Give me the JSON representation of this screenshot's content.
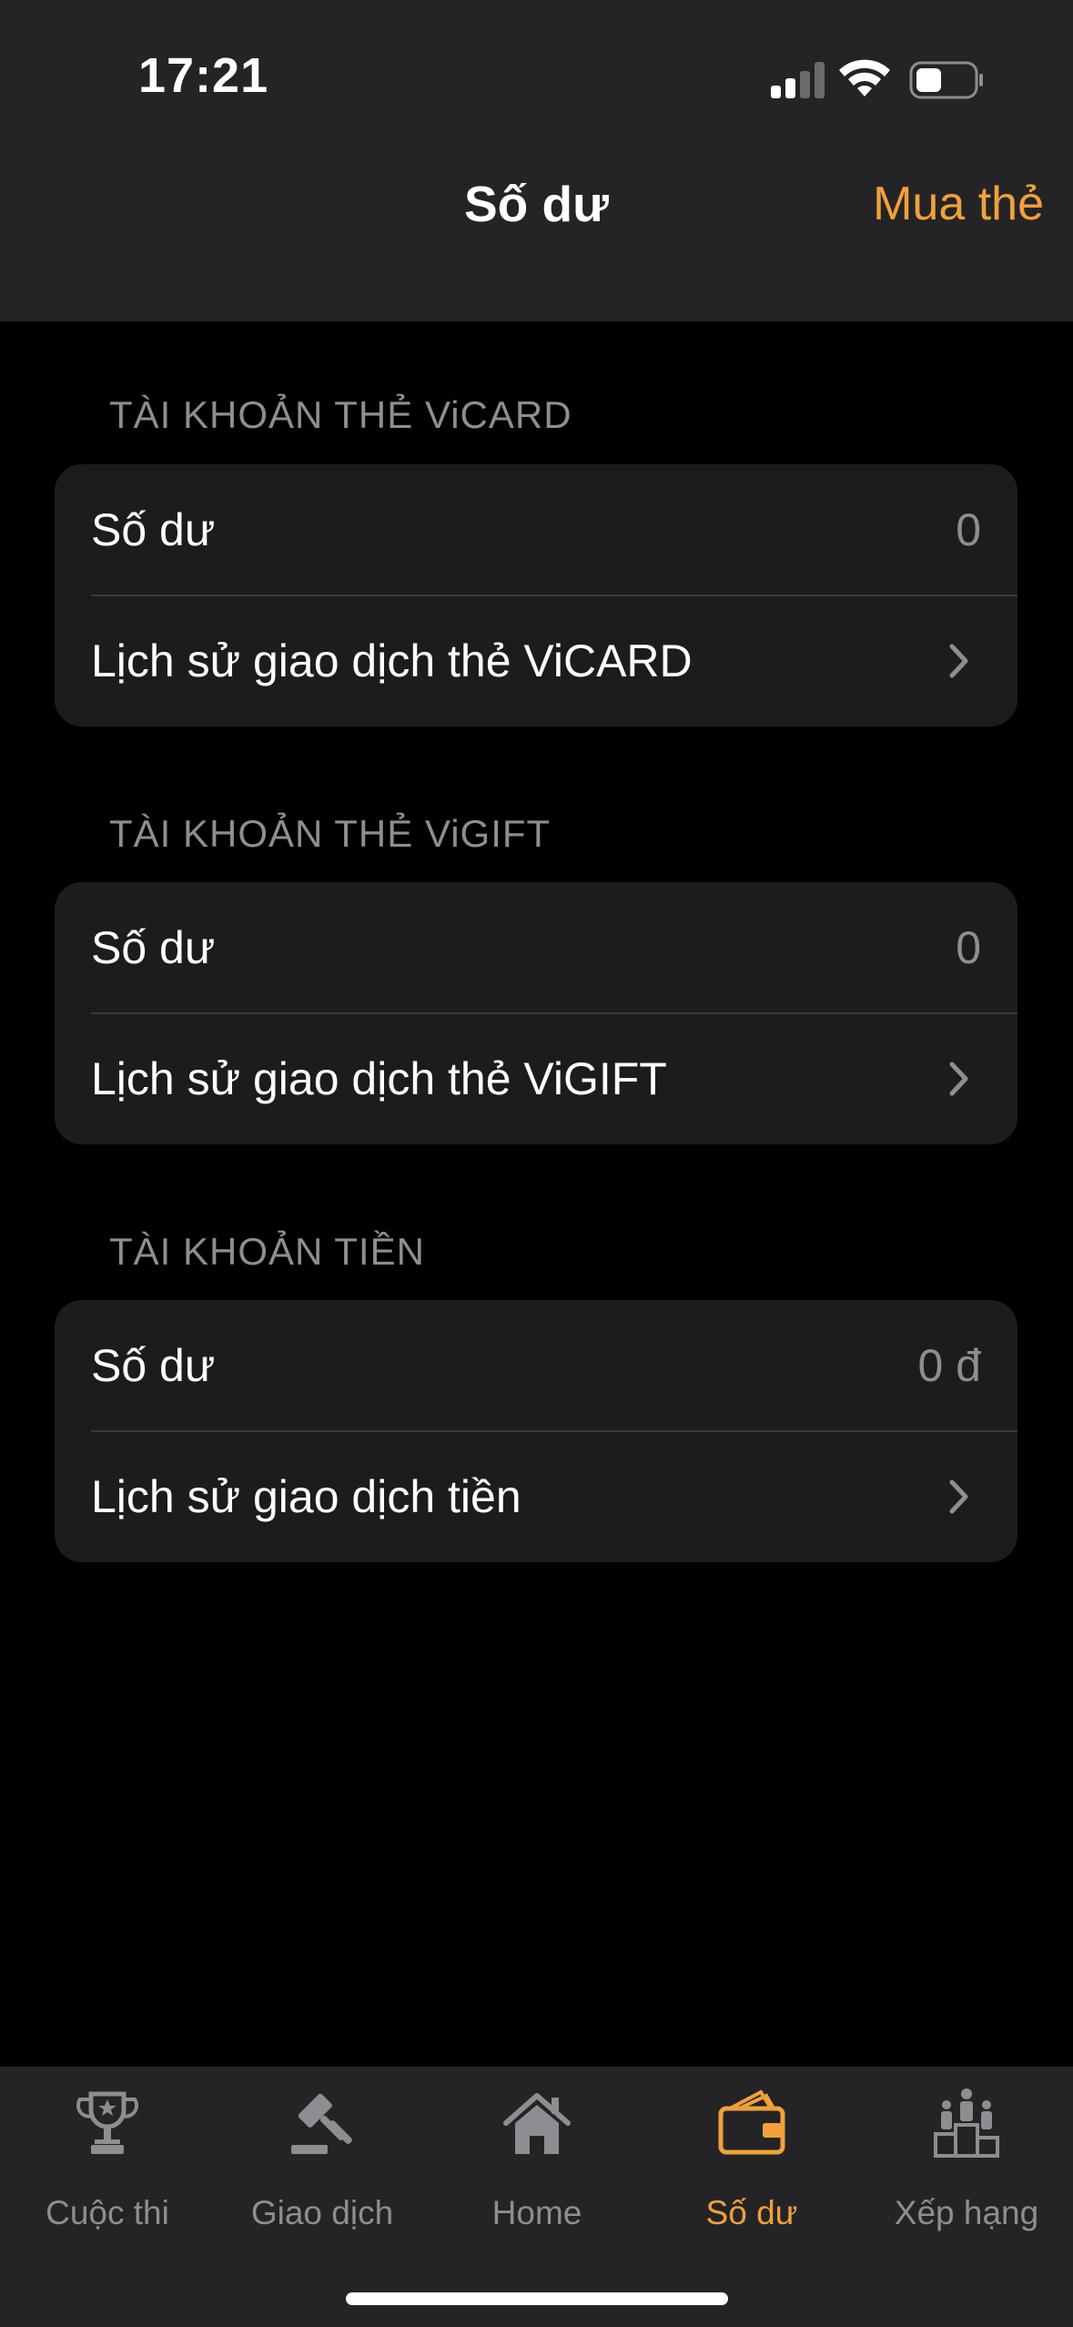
{
  "status_bar": {
    "time": "17:21"
  },
  "nav": {
    "title": "Số dư",
    "action_label": "Mua thẻ"
  },
  "sections": [
    {
      "header": "TÀI KHOẢN THẺ ViCARD",
      "balance_label": "Số dư",
      "balance_value": "0",
      "history_label": "Lịch sử giao dịch thẻ ViCARD"
    },
    {
      "header": "TÀI KHOẢN THẺ ViGIFT",
      "balance_label": "Số dư",
      "balance_value": "0",
      "history_label": "Lịch sử giao dịch thẻ ViGIFT"
    },
    {
      "header": "TÀI KHOẢN TIỀN",
      "balance_label": "Số dư",
      "balance_value": "0 đ",
      "history_label": "Lịch sử giao dịch tiền"
    }
  ],
  "tabbar": {
    "items": [
      {
        "label": "Cuộc thi",
        "icon": "trophy-icon",
        "active": false
      },
      {
        "label": "Giao dịch",
        "icon": "gavel-icon",
        "active": false
      },
      {
        "label": "Home",
        "icon": "home-icon",
        "active": false
      },
      {
        "label": "Số dư",
        "icon": "wallet-icon",
        "active": true
      },
      {
        "label": "Xếp hạng",
        "icon": "ranking-icon",
        "active": false
      }
    ]
  },
  "colors": {
    "accent": "#f0a13b",
    "nav_background": "#242426",
    "card_background": "#1c1c1e",
    "secondary_text": "#8d8d92"
  }
}
